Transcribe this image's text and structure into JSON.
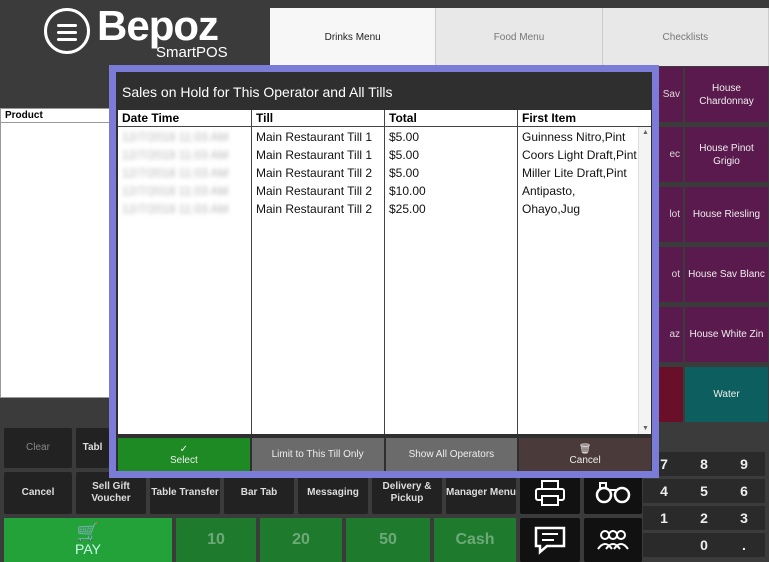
{
  "brand": {
    "name": "Bepoz",
    "sub": "SmartPOS"
  },
  "menu_tabs": [
    "Drinks Menu",
    "Food Menu",
    "Checklists"
  ],
  "product_panel": {
    "header": "Product"
  },
  "modal": {
    "title": "Sales on Hold for This Operator and All Tills",
    "columns": [
      "Date Time",
      "Till",
      "Total",
      "First Item"
    ],
    "rows": [
      {
        "datetime": "12/7/2018 11:03 AM",
        "till": "Main Restaurant Till 1",
        "total": "$5.00",
        "first_item": "Guinness Nitro,Pint"
      },
      {
        "datetime": "12/7/2018 11:03 AM",
        "till": "Main Restaurant Till 1",
        "total": "$5.00",
        "first_item": "Coors Light Draft,Pint"
      },
      {
        "datetime": "12/7/2018 11:03 AM",
        "till": "Main Restaurant Till 2",
        "total": "$5.00",
        "first_item": "Miller Lite Draft,Pint"
      },
      {
        "datetime": "12/7/2018 11:03 AM",
        "till": "Main Restaurant Till 2",
        "total": "$10.00",
        "first_item": "Antipasto,"
      },
      {
        "datetime": "12/7/2018 11:03 AM",
        "till": "Main Restaurant Till 2",
        "total": "$25.00",
        "first_item": "Ohayo,Jug"
      }
    ],
    "buttons": {
      "select": "Select",
      "limit": "Limit to This Till Only",
      "show_all": "Show All Operators",
      "cancel": "Cancel"
    }
  },
  "products": {
    "house_chardonnay": "House Chardonnay",
    "house_pinot_grigio": "House Pinot Grigio",
    "house_riesling": "House Riesling",
    "house_sav_blanc": "House Sav Blanc",
    "house_white_zin": "House White Zin",
    "water": "Water",
    "partial": [
      "Sav",
      "ec",
      "lot",
      "ot",
      "az",
      ""
    ]
  },
  "actions": {
    "clear": "Clear",
    "table_partial": "Tabl",
    "cancel": "Cancel",
    "sell_gift_voucher": "Sell Gift Voucher",
    "table_transfer": "Table Transfer",
    "bar_tab": "Bar Tab",
    "messaging": "Messaging",
    "delivery_pickup": "Delivery & Pickup",
    "manager_menu": "Manager Menu",
    "pay": "PAY",
    "ten": "10",
    "twenty": "20",
    "fifty": "50",
    "cash": "Cash"
  },
  "numpad": [
    "7",
    "8",
    "9",
    "4",
    "5",
    "6",
    "1",
    "2",
    "3",
    "",
    "0",
    "."
  ]
}
